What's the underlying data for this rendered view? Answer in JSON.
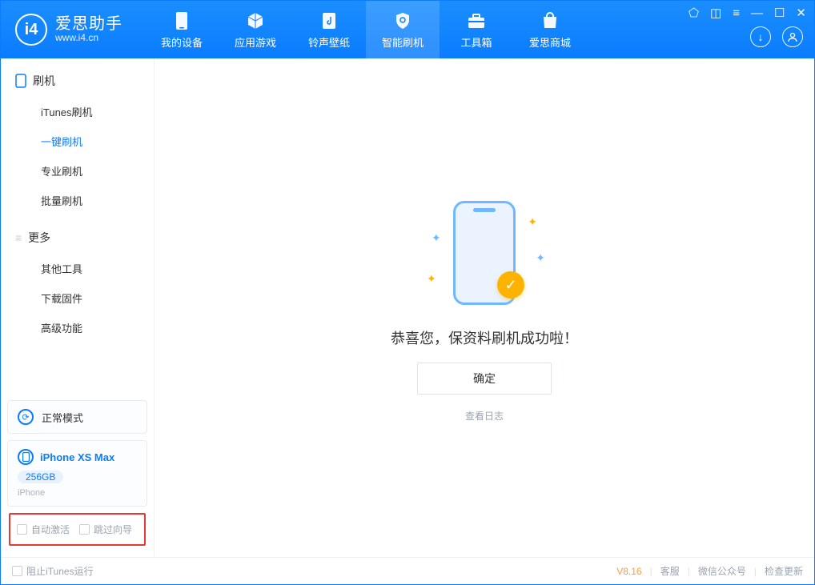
{
  "app": {
    "name_cn": "爱思助手",
    "url": "www.i4.cn"
  },
  "nav": {
    "my_device": "我的设备",
    "apps_games": "应用游戏",
    "ringtone_wallpaper": "铃声壁纸",
    "smart_flash": "智能刷机",
    "toolbox": "工具箱",
    "store": "爱思商城"
  },
  "sidebar": {
    "flash_header": "刷机",
    "itunes_flash": "iTunes刷机",
    "oneclick_flash": "一键刷机",
    "pro_flash": "专业刷机",
    "batch_flash": "批量刷机",
    "more_header": "更多",
    "other_tools": "其他工具",
    "download_firmware": "下载固件",
    "advanced": "高级功能"
  },
  "mode": {
    "label": "正常模式"
  },
  "device": {
    "name": "iPhone XS Max",
    "capacity": "256GB",
    "type": "iPhone"
  },
  "options": {
    "auto_activate": "自动激活",
    "skip_guide": "跳过向导"
  },
  "result": {
    "message": "恭喜您，保资料刷机成功啦！",
    "ok": "确定",
    "view_log": "查看日志"
  },
  "status": {
    "block_itunes": "阻止iTunes运行",
    "version": "V8.16",
    "support": "客服",
    "wechat": "微信公众号",
    "check_update": "检查更新"
  }
}
